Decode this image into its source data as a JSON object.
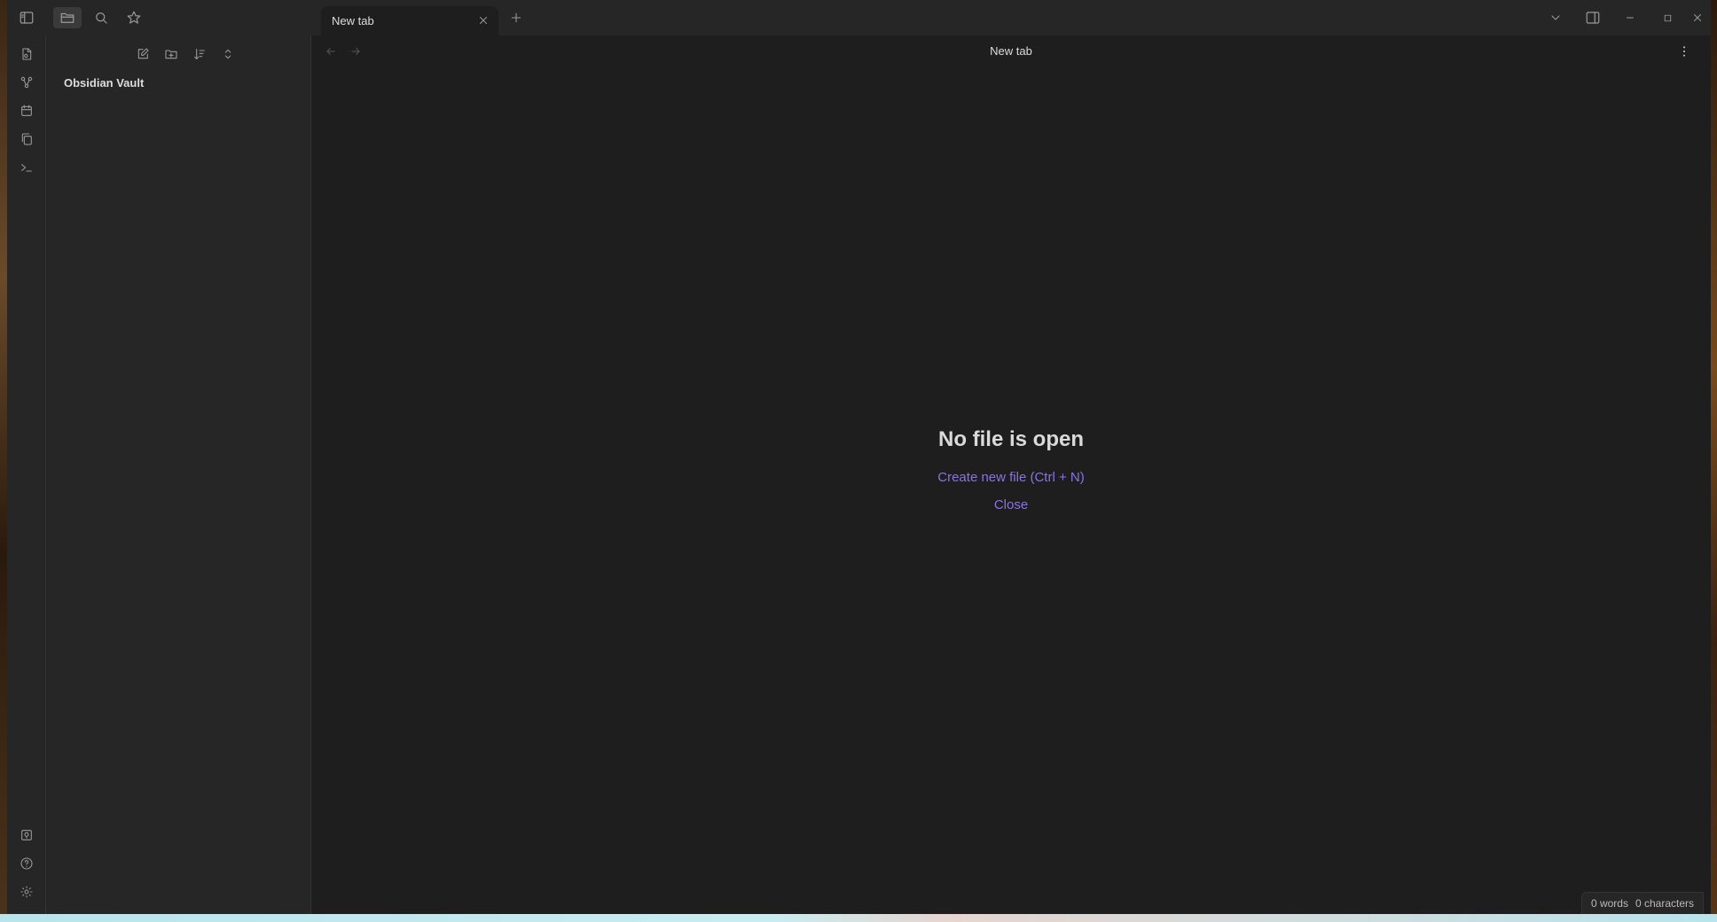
{
  "tabs": [
    {
      "label": "New tab"
    }
  ],
  "view": {
    "title": "New tab"
  },
  "sidebar": {
    "vault_name": "Obsidian Vault"
  },
  "empty_state": {
    "title": "No file is open",
    "create_link": "Create new file (Ctrl + N)",
    "close_link": "Close"
  },
  "status_bar": {
    "words": "0 words",
    "characters": "0 characters"
  },
  "icons": {
    "titlebar": [
      "sidebar-toggle-icon",
      "folder-icon",
      "search-icon",
      "star-icon"
    ],
    "ribbon_top": [
      "open-quick-switcher-icon",
      "graph-view-icon",
      "calendar-icon",
      "copy-icon",
      "terminal-icon"
    ],
    "ribbon_bottom": [
      "vault-switcher-icon",
      "help-icon",
      "settings-icon"
    ],
    "sidebar_tools": [
      "new-note-icon",
      "new-folder-icon",
      "sort-icon",
      "collapse-icon"
    ]
  },
  "colors": {
    "accent": "#8a73e6",
    "background": "#1e1e1e",
    "panel": "#262626"
  }
}
